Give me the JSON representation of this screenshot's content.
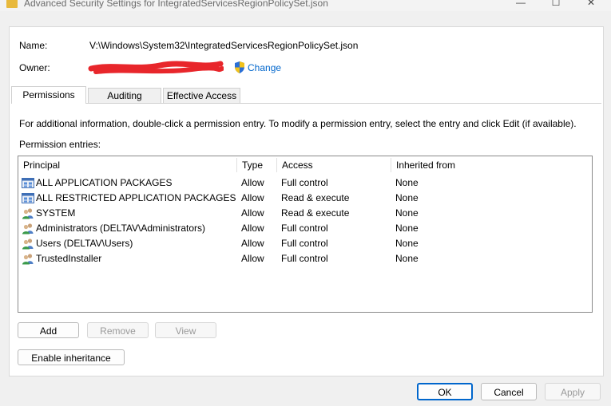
{
  "window": {
    "title": "Advanced Security Settings for IntegratedServicesRegionPolicySet.json",
    "min_glyph": "—",
    "max_glyph": "☐",
    "close_glyph": "✕"
  },
  "name_label": "Name:",
  "name_value": "V:\\Windows\\System32\\IntegratedServicesRegionPolicySet.json",
  "owner_label": "Owner:",
  "owner_change": "Change",
  "tabs": [
    {
      "label": "Permissions",
      "active": true
    },
    {
      "label": "Auditing",
      "active": false
    },
    {
      "label": "Effective Access",
      "active": false
    }
  ],
  "info_text": "For additional information, double-click a permission entry. To modify a permission entry, select the entry and click Edit (if available).",
  "permission_entries_label": "Permission entries:",
  "columns": {
    "principal": "Principal",
    "type": "Type",
    "access": "Access",
    "inherited": "Inherited from"
  },
  "entries": [
    {
      "principal": "ALL APPLICATION PACKAGES",
      "type": "Allow",
      "access": "Full control",
      "inherited": "None",
      "icon": "app-package-icon"
    },
    {
      "principal": "ALL RESTRICTED APPLICATION PACKAGES",
      "type": "Allow",
      "access": "Read & execute",
      "inherited": "None",
      "icon": "app-package-icon"
    },
    {
      "principal": "SYSTEM",
      "type": "Allow",
      "access": "Read & execute",
      "inherited": "None",
      "icon": "users-group-icon"
    },
    {
      "principal": "Administrators (DELTAV\\Administrators)",
      "type": "Allow",
      "access": "Full control",
      "inherited": "None",
      "icon": "users-group-icon"
    },
    {
      "principal": "Users (DELTAV\\Users)",
      "type": "Allow",
      "access": "Full control",
      "inherited": "None",
      "icon": "users-group-icon"
    },
    {
      "principal": "TrustedInstaller",
      "type": "Allow",
      "access": "Full control",
      "inherited": "None",
      "icon": "users-group-icon"
    }
  ],
  "buttons": {
    "add": "Add",
    "remove": "Remove",
    "view": "View",
    "enable_inheritance": "Enable inheritance",
    "ok": "OK",
    "cancel": "Cancel",
    "apply": "Apply"
  },
  "colors": {
    "link": "#0066cc",
    "redaction": "#e8262b",
    "primary_button_border": "#0066cc"
  }
}
